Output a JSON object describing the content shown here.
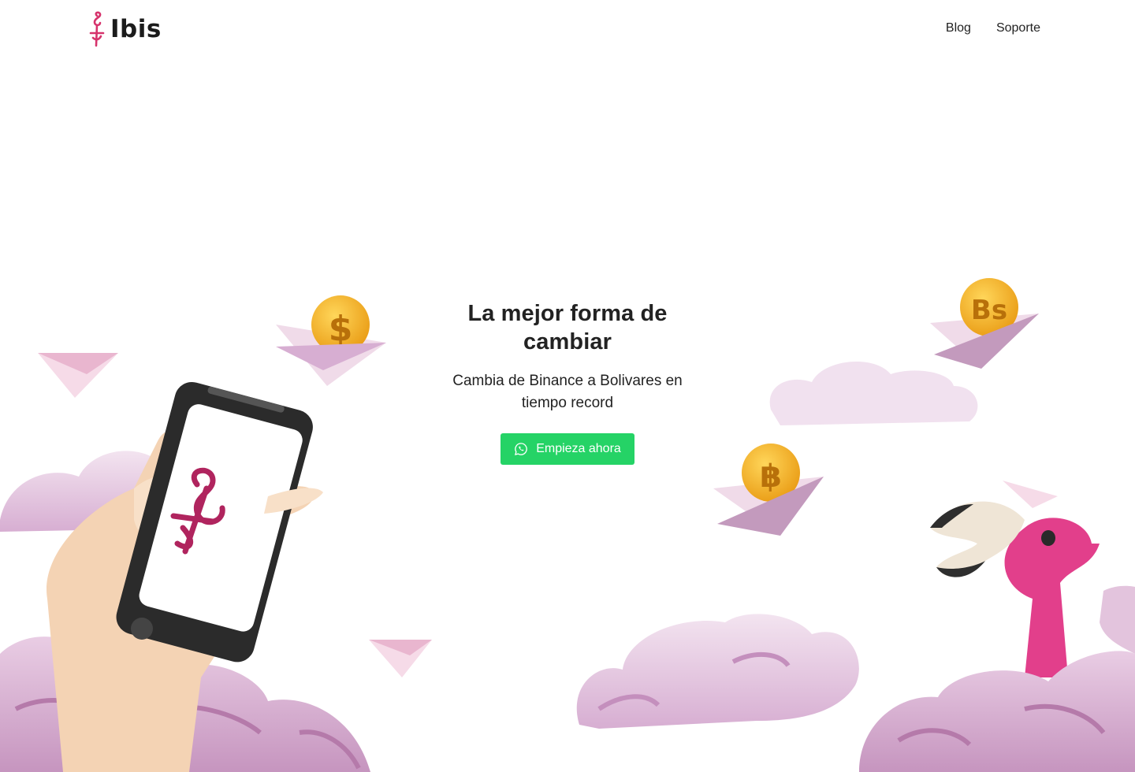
{
  "brand": {
    "name": "Ibis",
    "accent": "#d6336c",
    "cta_color": "#25d366"
  },
  "nav": {
    "items": [
      {
        "label": "Blog"
      },
      {
        "label": "Soporte"
      }
    ]
  },
  "hero": {
    "title": "La mejor forma de cambiar",
    "subtitle": "Cambia de Binance a Bolivares en tiempo record",
    "cta_label": "Empieza ahora",
    "cta_icon": "whatsapp-icon"
  },
  "illustration": {
    "coins": [
      "$",
      "฿",
      "Bs"
    ]
  }
}
